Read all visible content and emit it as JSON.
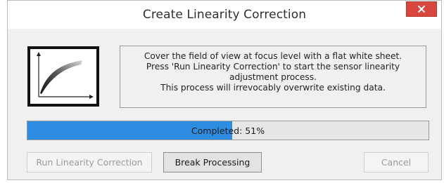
{
  "window": {
    "title": "Create Linearity Correction",
    "close_icon": "close-icon"
  },
  "colors": {
    "close_button": "#d9463d",
    "progress_fill": "#2e8de0"
  },
  "graph": {
    "icon": "linearity-curve-icon"
  },
  "message": {
    "line1": "Cover the field of view at focus level with a flat white sheet.",
    "line2": "Press 'Run Linearity Correction' to start the sensor linearity adjustment process.",
    "line3": "This process will irrevocably overwrite existing data."
  },
  "progress": {
    "label": "Completed: 51%",
    "fraction": 0.51
  },
  "buttons": {
    "run_label": "Run Linearity Correction",
    "run_enabled": false,
    "break_label": "Break Processing",
    "break_enabled": true,
    "cancel_label": "Cancel",
    "cancel_enabled": false
  }
}
